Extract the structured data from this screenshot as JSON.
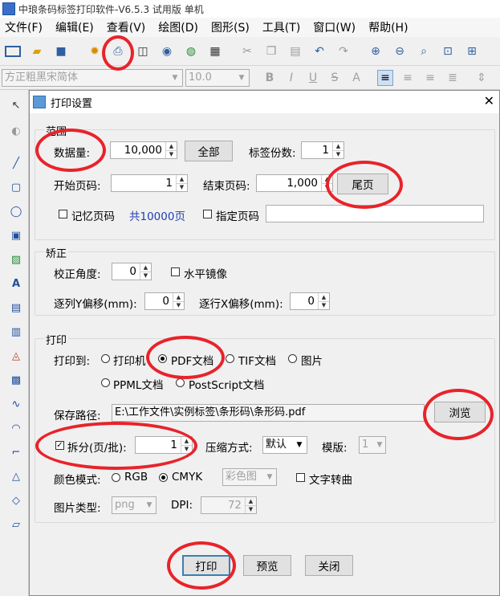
{
  "app": {
    "title": "中琅条码标签打印软件-V6.5.3 试用版 单机"
  },
  "menu": [
    "文件(F)",
    "编辑(E)",
    "查看(V)",
    "绘图(D)",
    "图形(S)",
    "工具(T)",
    "窗口(W)",
    "帮助(H)"
  ],
  "fontbar": {
    "font": "方正粗黑宋简体",
    "size": "10.0",
    "bold": "B",
    "italic": "I",
    "underline": "U",
    "strike": "S"
  },
  "dialog": {
    "title": "打印设置",
    "range": {
      "legend": "范围",
      "qty_label": "数据量:",
      "qty_value": "10,000",
      "all_button": "全部",
      "copies_label": "标签份数:",
      "copies_value": "1",
      "start_label": "开始页码:",
      "start_value": "1",
      "end_label": "结束页码:",
      "end_value": "1,000",
      "last_button": "尾页",
      "remember_label": "记忆页码",
      "total_pages": "共10000页",
      "specify_label": "指定页码"
    },
    "correction": {
      "legend": "矫正",
      "angle_label": "校正角度:",
      "angle_value": "0",
      "mirror_label": "水平镜像",
      "col_offset_label": "逐列Y偏移(mm):",
      "col_offset_value": "0",
      "row_offset_label": "逐行X偏移(mm):",
      "row_offset_value": "0"
    },
    "print": {
      "legend": "打印",
      "to_label": "打印到:",
      "opt_printer": "打印机",
      "opt_pdf": "PDF文档",
      "opt_tif": "TIF文档",
      "opt_image": "图片",
      "opt_ppml": "PPML文档",
      "opt_ps": "PostScript文档",
      "path_label": "保存路径:",
      "path_value": "E:\\工作文件\\实例标签\\条形码\\条形码.pdf",
      "browse_button": "浏览",
      "split_label": "拆分(页/批):",
      "split_value": "1",
      "compress_label": "压缩方式:",
      "compress_value": "默认",
      "template_label": "模版:",
      "template_value": "1",
      "color_label": "颜色模式:",
      "opt_rgb": "RGB",
      "opt_cmyk": "CMYK",
      "color_combo": "彩色图",
      "text_curve_label": "文字转曲",
      "img_type_label": "图片类型:",
      "img_type_value": "png",
      "dpi_label": "DPI:",
      "dpi_value": "72"
    },
    "buttons": {
      "print": "打印",
      "preview": "预览",
      "close": "关闭"
    }
  },
  "colors": {
    "annotation": "#e8232a",
    "accent": "#3c7fb1",
    "total_pages": "#1f3fb0"
  }
}
